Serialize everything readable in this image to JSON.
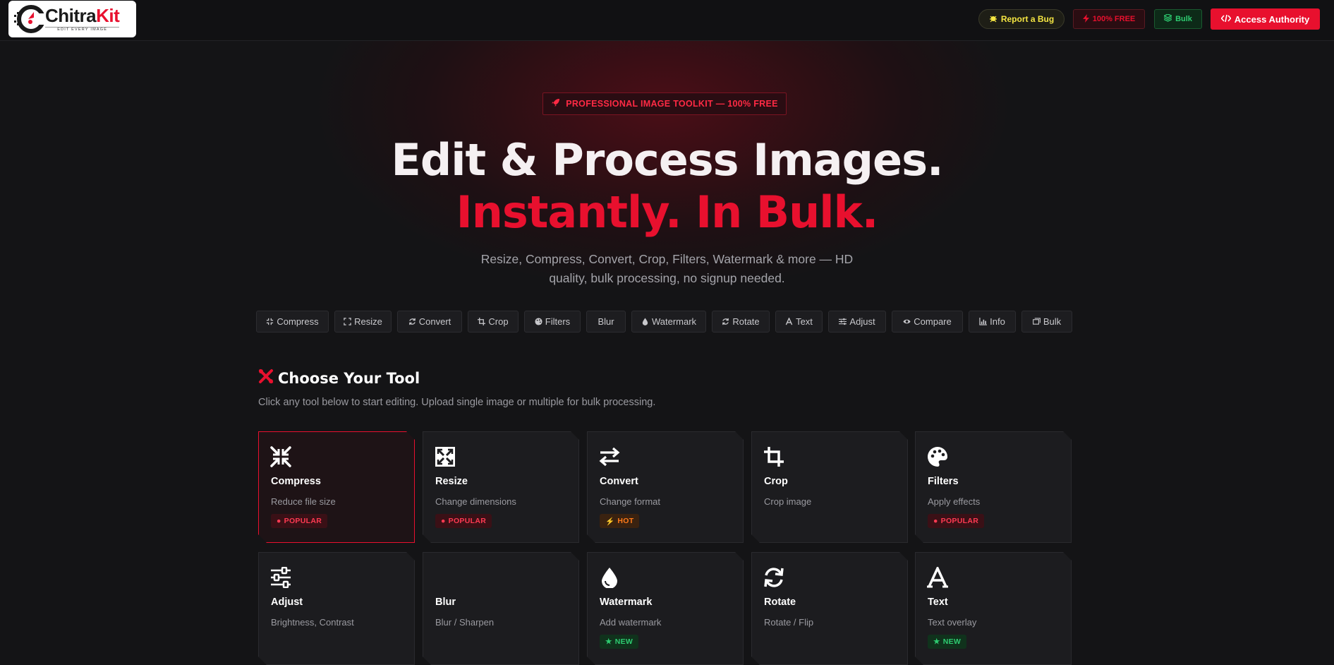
{
  "header": {
    "logo": {
      "brand_main": "Chitra",
      "brand_accent": "Kit",
      "tagline": "EDIT EVERY IMAGE"
    },
    "report_bug": "Report a Bug",
    "free_badge": "100% FREE",
    "bulk_badge": "Bulk",
    "access_button": "Access Authority"
  },
  "hero": {
    "badge": "PROFESSIONAL IMAGE TOOLKIT — 100% FREE",
    "title_line1": "Edit & Process Images.",
    "title_line2": "Instantly. In Bulk.",
    "subtitle": "Resize, Compress, Convert, Crop, Filters, Watermark & more — HD quality, bulk processing, no signup needed."
  },
  "chips": [
    {
      "label": "Compress",
      "icon": "compress-icon"
    },
    {
      "label": "Resize",
      "icon": "expand-icon"
    },
    {
      "label": "Convert",
      "icon": "sync-icon"
    },
    {
      "label": "Crop",
      "icon": "crop-icon"
    },
    {
      "label": "Filters",
      "icon": "palette-icon"
    },
    {
      "label": "Blur",
      "icon": ""
    },
    {
      "label": "Watermark",
      "icon": "droplet-icon"
    },
    {
      "label": "Rotate",
      "icon": "sync-icon"
    },
    {
      "label": "Text",
      "icon": "font-icon"
    },
    {
      "label": "Adjust",
      "icon": "sliders-icon"
    },
    {
      "label": "Compare",
      "icon": "eye-icon"
    },
    {
      "label": "Info",
      "icon": "chart-icon"
    },
    {
      "label": "Bulk",
      "icon": "images-icon"
    }
  ],
  "section": {
    "title": "Choose Your Tool",
    "subtitle": "Click any tool below to start editing. Upload single image or multiple for bulk processing."
  },
  "cards": [
    {
      "title": "Compress",
      "desc": "Reduce file size",
      "tag": "POPULAR",
      "tag_type": "pop",
      "icon": "compress-icon"
    },
    {
      "title": "Resize",
      "desc": "Change dimensions",
      "tag": "POPULAR",
      "tag_type": "pop",
      "icon": "expand-icon"
    },
    {
      "title": "Convert",
      "desc": "Change format",
      "tag": "HOT",
      "tag_type": "hot",
      "icon": "arrows-icon"
    },
    {
      "title": "Crop",
      "desc": "Crop image",
      "tag": "",
      "tag_type": "",
      "icon": "crop-icon"
    },
    {
      "title": "Filters",
      "desc": "Apply effects",
      "tag": "POPULAR",
      "tag_type": "pop",
      "icon": "palette-icon"
    },
    {
      "title": "Adjust",
      "desc": "Brightness, Contrast",
      "tag": "",
      "tag_type": "",
      "icon": "sliders-icon"
    },
    {
      "title": "Blur",
      "desc": "Blur / Sharpen",
      "tag": "",
      "tag_type": "",
      "icon": ""
    },
    {
      "title": "Watermark",
      "desc": "Add watermark",
      "tag": "NEW",
      "tag_type": "new",
      "icon": "droplet-icon"
    },
    {
      "title": "Rotate",
      "desc": "Rotate / Flip",
      "tag": "",
      "tag_type": "",
      "icon": "sync-icon"
    },
    {
      "title": "Text",
      "desc": "Text overlay",
      "tag": "NEW",
      "tag_type": "new",
      "icon": "font-icon"
    }
  ],
  "colors": {
    "accent": "#e8102e",
    "background": "#141416",
    "card": "#1c1c1f"
  }
}
